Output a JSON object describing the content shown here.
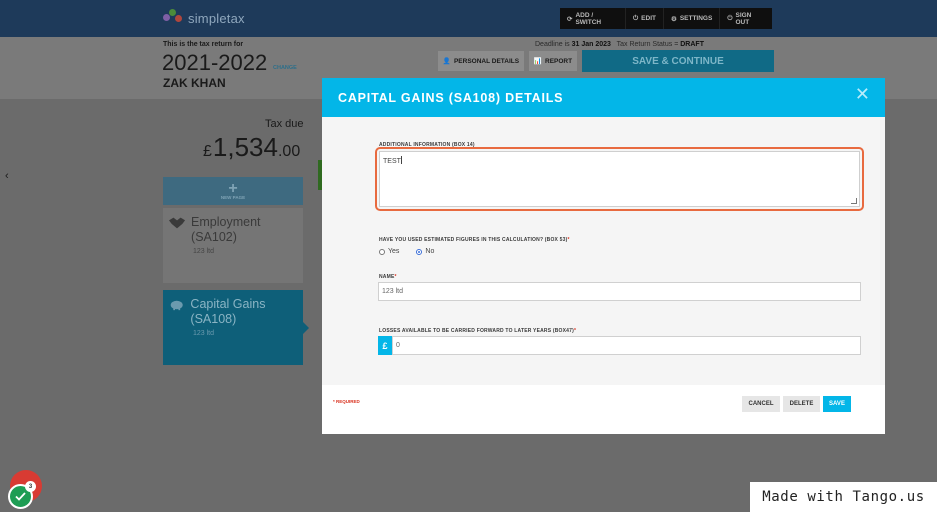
{
  "app": {
    "logo_text": "simpletax",
    "nav": [
      {
        "label": "ADD / SWITCH",
        "icon": "refresh-icon"
      },
      {
        "label": "EDIT",
        "icon": "power-icon"
      },
      {
        "label": "SETTINGS",
        "icon": "gear-icon"
      },
      {
        "label": "SIGN OUT",
        "icon": "power-icon"
      }
    ]
  },
  "header": {
    "subtitle": "This is the tax return for",
    "year": "2021-2022",
    "change_label": "CHANGE",
    "name": "ZAK KHAN",
    "deadline_label": "Deadline is",
    "deadline_value": "31 Jan 2023",
    "status_label": "Tax Return Status =",
    "status_value": "DRAFT",
    "personal_details_label": "PERSONAL DETAILS",
    "report_label": "REPORT",
    "save_continue_label": "SAVE & CONTINUE"
  },
  "summary": {
    "tax_due_label": "Tax due",
    "currency": "£",
    "amount": "1,534",
    "decimals": ".00",
    "new_page_label": "NEW PAGE",
    "cards": [
      {
        "title": "Employment (SA102)",
        "sub": "123 ltd",
        "icon": "handshake-icon"
      },
      {
        "title": "Capital Gains (SA108)",
        "sub": "123 ltd",
        "icon": "piggy-bank-icon"
      }
    ]
  },
  "modal": {
    "title": "CAPITAL GAINS (SA108) DETAILS",
    "additional_info_label": "ADDITIONAL INFORMATION (BOX 14)",
    "additional_info_value": "TEST",
    "estimated_label": "HAVE YOU USED ESTIMATED FIGURES IN THIS CALCULATION? (BOX 53)",
    "required_mark": "*",
    "yes_label": "Yes",
    "no_label": "No",
    "estimated_selected": "No",
    "name_label": "NAME",
    "name_value": "123 ltd",
    "losses_label": "LOSSES AVAILABLE TO BE CARRIED FORWARD TO LATER YEARS (BOX47)",
    "losses_currency": "£",
    "losses_value": "0",
    "required_note": "* REQUIRED",
    "cancel_label": "CANCEL",
    "delete_label": "DELETE",
    "save_label": "SAVE"
  },
  "tango": {
    "badge_text": "Made with Tango.us",
    "widget_count": "3"
  },
  "colors": {
    "accent": "#03b6e8",
    "focus_border": "#e86a3f",
    "required": "#d9321f",
    "topbar": "#1e3a5a"
  }
}
